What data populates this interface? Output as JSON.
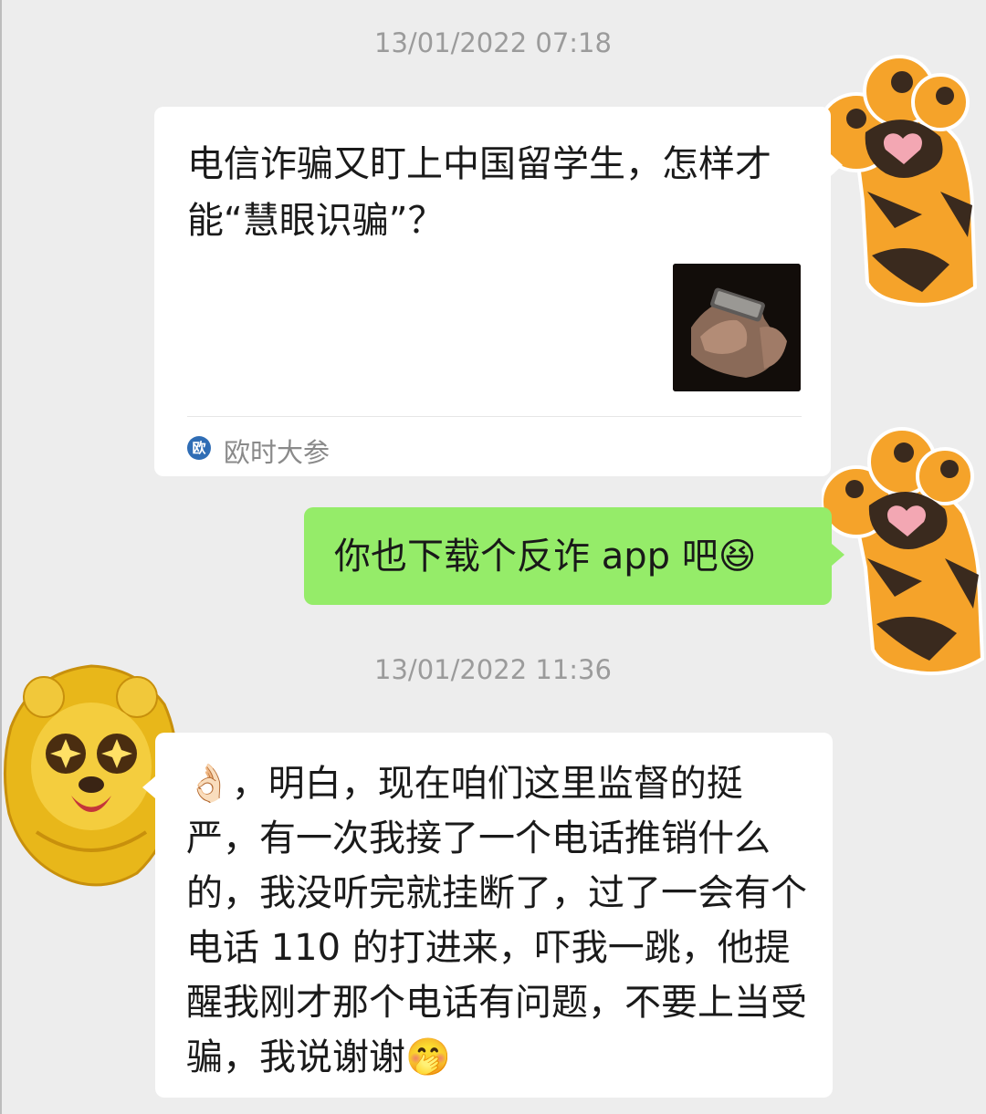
{
  "timestamps": [
    "13/01/2022 07:18",
    "13/01/2022 11:36"
  ],
  "article_card": {
    "title": "电信诈骗又盯上中国留学生，怎样才能“慧眼识骗”？",
    "source_name": "欧时大参",
    "source_icon": "欧"
  },
  "sent_message": {
    "text": "你也下载个反诈 app 吧😆"
  },
  "received_message": {
    "text": "👌🏻，明白，现在咱们这里监督的挺严，有一次我接了一个电话推销什么的，我没听完就挂断了，过了一会有个电话 110 的打进来，吓我一跳，他提醒我刚才那个电话有问题，不要上当受骗，我说谢谢🤭"
  },
  "colors": {
    "background": "#ededed",
    "sent_bubble": "#95ec69",
    "received_bubble": "#ffffff",
    "timestamp_text": "#9b9b9b",
    "paw_orange": "#f5a32a",
    "paw_pad": "#3a2a1e",
    "paw_heart": "#f3a7b3",
    "lion_gold": "#e8b71a"
  },
  "icons": {
    "avatar_right": "tiger-paw",
    "avatar_left": "golden-lion",
    "source": "news-source-icon"
  }
}
